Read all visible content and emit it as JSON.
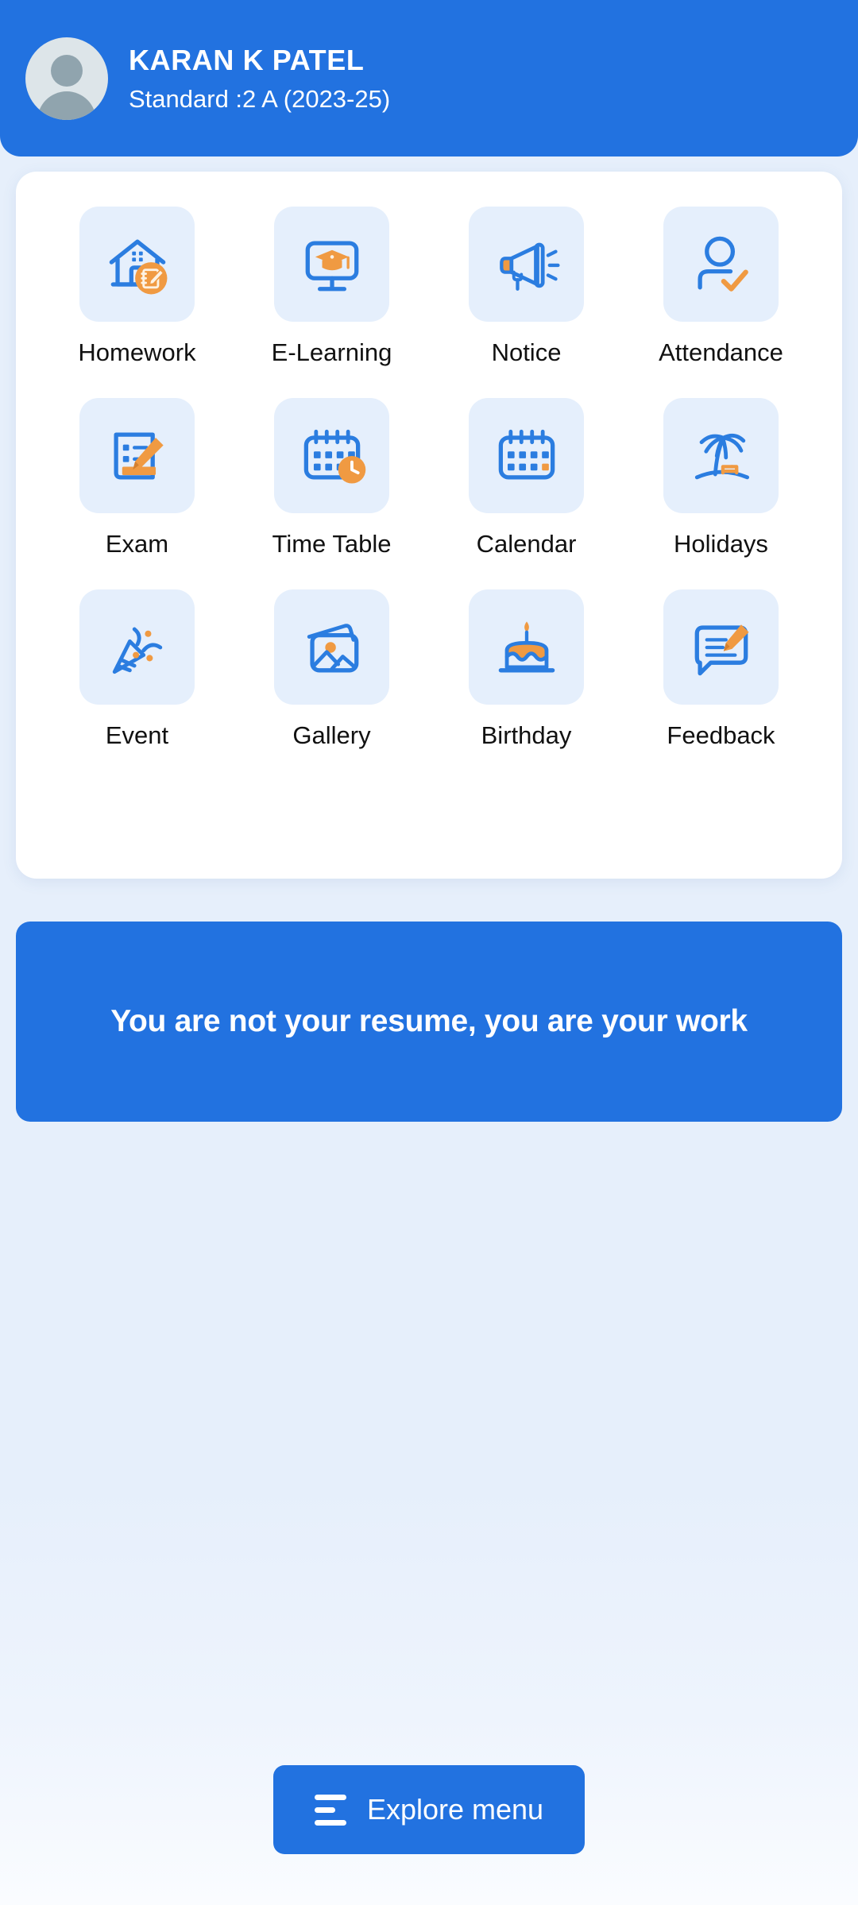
{
  "colors": {
    "primary_blue": "#2272e0",
    "icon_blue": "#2b7de0",
    "accent_orange": "#f09a42",
    "page_background": "#e6effb",
    "tile_background": "#e5effc",
    "card_background": "#ffffff",
    "avatar_background": "#dde5e9",
    "text_dark": "#111111",
    "text_on_primary": "#ffffff"
  },
  "header": {
    "avatar_icon": "user-avatar-placeholder-icon",
    "student_name": "KARAN K PATEL",
    "student_class": "Standard :2 A (2023-25)"
  },
  "menu": {
    "items": [
      {
        "label": "Homework",
        "icon": "house-with-notebook-badge-icon"
      },
      {
        "label": "E-Learning",
        "icon": "monitor-with-graduation-cap-icon"
      },
      {
        "label": "Notice",
        "icon": "megaphone-icon"
      },
      {
        "label": "Attendance",
        "icon": "person-with-check-icon"
      },
      {
        "label": "Exam",
        "icon": "document-checklist-pencil-icon"
      },
      {
        "label": "Time Table",
        "icon": "calendar-with-clock-icon"
      },
      {
        "label": "Calendar",
        "icon": "calendar-icon"
      },
      {
        "label": "Holidays",
        "icon": "palm-tree-beach-icon"
      },
      {
        "label": "Event",
        "icon": "party-popper-icon"
      },
      {
        "label": "Gallery",
        "icon": "photo-stack-icon"
      },
      {
        "label": "Birthday",
        "icon": "birthday-cake-icon"
      },
      {
        "label": "Feedback",
        "icon": "speech-bubble-pencil-icon"
      }
    ]
  },
  "quote_banner": {
    "text": "You are not your resume, you are your work"
  },
  "bottom_bar": {
    "explore_label": "Explore menu",
    "explore_icon": "hamburger-menu-icon"
  }
}
